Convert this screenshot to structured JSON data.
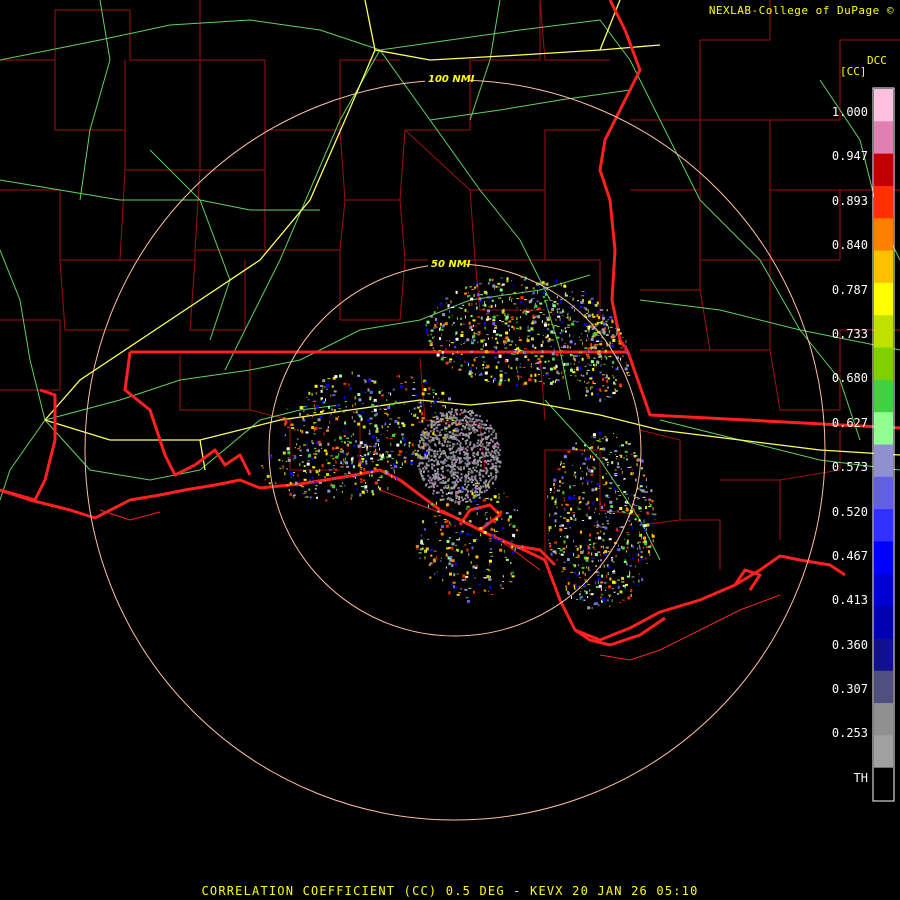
{
  "header": {
    "credit": "NEXLAB-College of DuPage ©",
    "product_code": "DCC",
    "product_units": "[CC]"
  },
  "rings": [
    {
      "label": "100 NMI"
    },
    {
      "label": "50 NMI"
    }
  ],
  "legend": {
    "labels": [
      "1.000",
      "0.947",
      "0.893",
      "0.840",
      "0.787",
      "0.733",
      "0.680",
      "0.627",
      "0.573",
      "0.520",
      "0.467",
      "0.413",
      "0.360",
      "0.307",
      "0.253",
      "TH"
    ],
    "colors": [
      "#ffc0e0",
      "#e080b0",
      "#c00000",
      "#ff3000",
      "#ff8000",
      "#ffc000",
      "#ffff00",
      "#c0e000",
      "#80d000",
      "#40d040",
      "#90ff90",
      "#9090d0",
      "#6060e0",
      "#3030ff",
      "#0000ff",
      "#0000d0",
      "#0000b0",
      "#101090",
      "#505080",
      "#909090",
      "#a0a0a0",
      "#000000"
    ]
  },
  "colors": {
    "background": "#000000",
    "text": "#ffff00",
    "state_border": "#ff2020",
    "county_border": "#b01010",
    "highway": "#ffff60",
    "road": "#60d060",
    "ring": "#ffc0a0"
  },
  "footer": {
    "caption": "CORRELATION COEFFICIENT (CC) 0.5 DEG - KEVX 20 JAN 26 05:10"
  }
}
